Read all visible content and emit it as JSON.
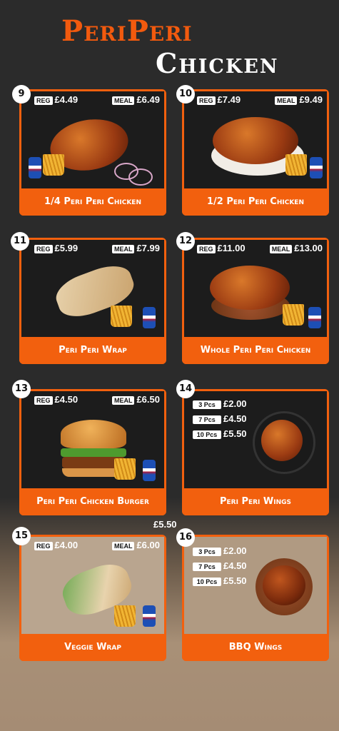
{
  "header": {
    "line1": "PeriPeri",
    "line2": "Chicken"
  },
  "stray_price": "£5.50",
  "items": [
    {
      "num": "9",
      "reg_tag": "REG",
      "reg": "£4.49",
      "meal_tag": "MEAL",
      "meal": "£6.49",
      "name": "1/4 Peri Peri Chicken"
    },
    {
      "num": "10",
      "reg_tag": "REG",
      "reg": "£7.49",
      "meal_tag": "MEAL",
      "meal": "£9.49",
      "name": "1/2 Peri Peri Chicken"
    },
    {
      "num": "11",
      "reg_tag": "REG",
      "reg": "£5.99",
      "meal_tag": "MEAL",
      "meal": "£7.99",
      "name": "Peri Peri Wrap"
    },
    {
      "num": "12",
      "reg_tag": "REG",
      "reg": "£11.00",
      "meal_tag": "MEAL",
      "meal": "£13.00",
      "name": "Whole Peri Peri Chicken"
    },
    {
      "num": "13",
      "reg_tag": "REG",
      "reg": "£4.50",
      "meal_tag": "MEAL",
      "meal": "£6.50",
      "name": "Peri Peri Chicken Burger"
    },
    {
      "num": "15",
      "reg_tag": "REG",
      "reg": "£4.00",
      "meal_tag": "MEAL",
      "meal": "£6.00",
      "name": "Veggie Wrap"
    }
  ],
  "wings": [
    {
      "num": "14",
      "name": "Peri Peri Wings",
      "sizes": [
        {
          "tag": "3 Pcs",
          "price": "£2.00"
        },
        {
          "tag": "7 Pcs",
          "price": "£4.50"
        },
        {
          "tag": "10 Pcs",
          "price": "£5.50"
        }
      ]
    },
    {
      "num": "16",
      "name": "BBQ Wings",
      "sizes": [
        {
          "tag": "3 Pcs",
          "price": "£2.00"
        },
        {
          "tag": "7 Pcs",
          "price": "£4.50"
        },
        {
          "tag": "10 Pcs",
          "price": "£5.50"
        }
      ]
    }
  ],
  "can_label": "PEPSI",
  "colors": {
    "accent": "#f2600e",
    "background": "#2b2b2b",
    "text": "#ffffff"
  }
}
